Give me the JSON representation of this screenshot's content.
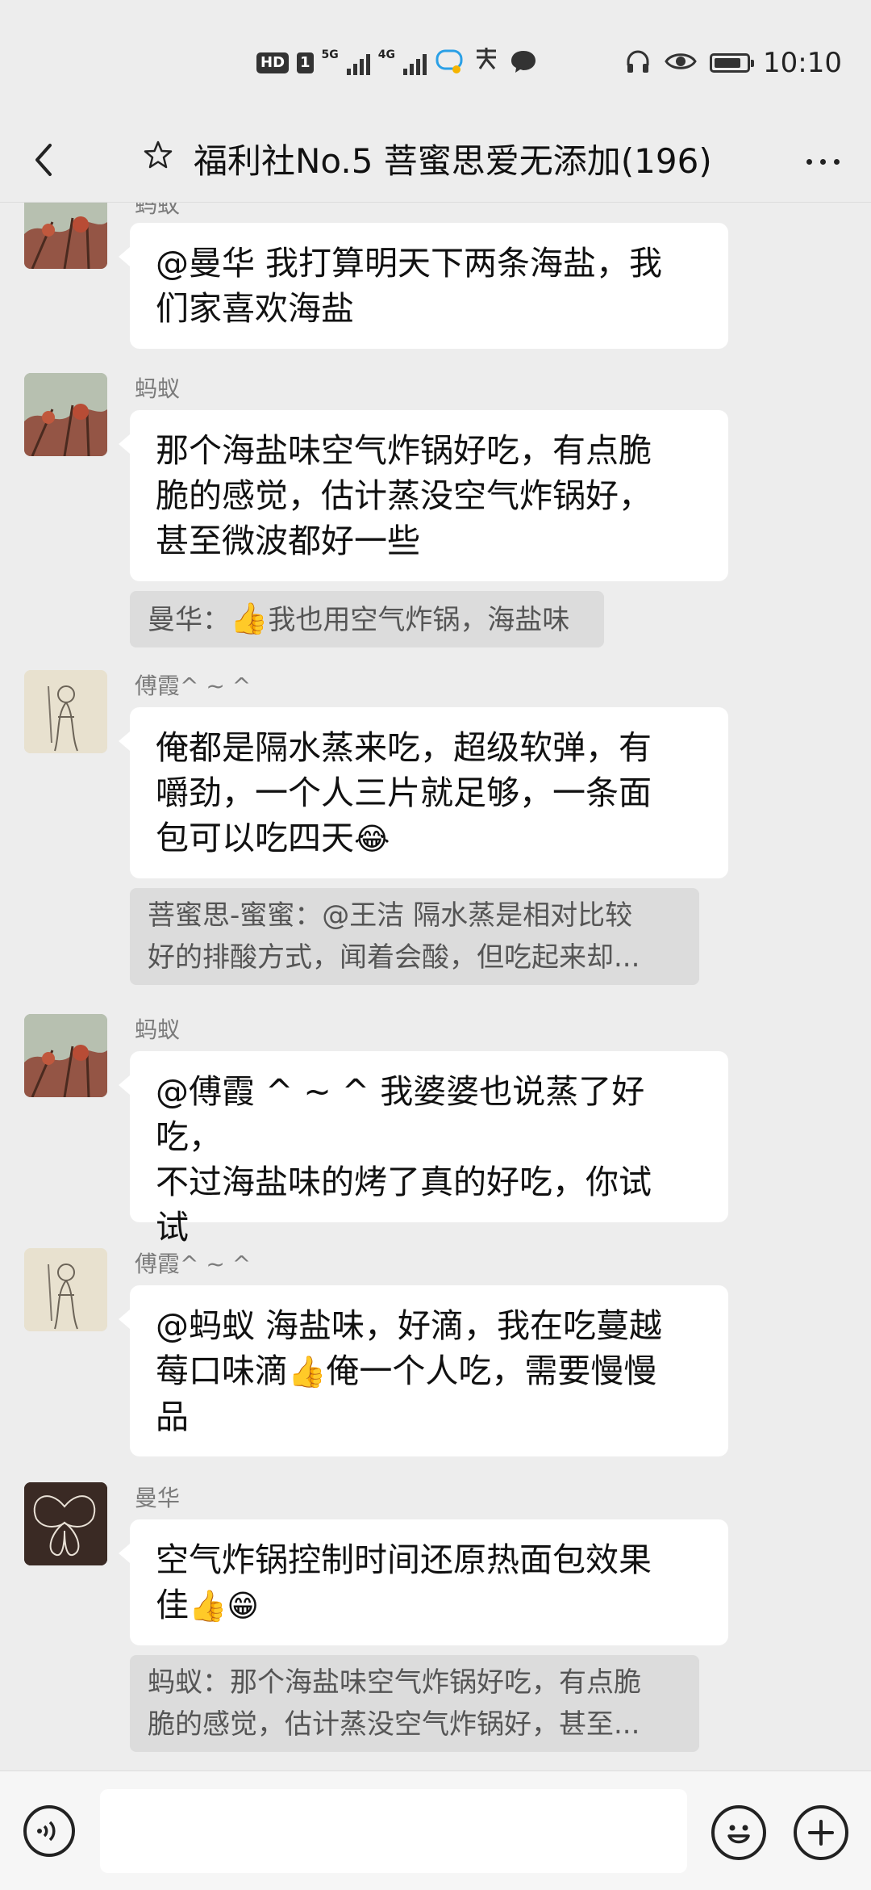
{
  "status_bar": {
    "hd": "HD",
    "sim": "1",
    "net1": "5G",
    "net2": "4G",
    "time": "10:10"
  },
  "header": {
    "title": "福利社No.5 菩蜜思爱无添加(196)"
  },
  "messages": [
    {
      "sender": "蚂蚁",
      "text": "@曼华  我打算明天下两条海盐，我们家喜欢海盐",
      "line1": "@曼华  我打算明天下两条海盐，我",
      "line2": "们家喜欢海盐",
      "avatar": "tree-painting"
    },
    {
      "sender": "蚂蚁",
      "line1": "那个海盐味空气炸锅好吃，有点脆",
      "line2": "脆的感觉，估计蒸没空气炸锅好，",
      "line3": "甚至微波都好一些",
      "avatar": "tree-painting",
      "quote": {
        "prefix": "曼华：",
        "emoji": "👍",
        "text": "我也用空气炸锅，海盐味"
      }
    },
    {
      "sender": "傅霞^ ~ ^",
      "line1": "俺都是隔水蒸来吃，超级软弹，有",
      "line2": "嚼劲，一个人三片就足够，一条面",
      "line3": "包可以吃四天",
      "line3_emoji": "😂",
      "avatar": "woman-sketch",
      "quote": {
        "line1": "菩蜜思-蜜蜜：@王洁 隔水蒸是相对比较",
        "line2": "好的排酸方式，闻着会酸，但吃起来却..."
      }
    },
    {
      "sender": "蚂蚁",
      "line1": "@傅霞 ^ ~ ^ 我婆婆也说蒸了好吃，",
      "line2": "不过海盐味的烤了真的好吃，你试",
      "line3": "试",
      "avatar": "tree-painting"
    },
    {
      "sender": "傅霞^ ~ ^",
      "line1": "@蚂蚁  海盐味，好滴，我在吃蔓越",
      "line2a": "莓口味滴",
      "line2_emoji": "👍",
      "line2b": "俺一个人吃，需要慢慢",
      "line3": "品",
      "avatar": "woman-sketch"
    },
    {
      "sender": "曼华",
      "line1": "空气炸锅控制时间还原热面包效果",
      "line2": "佳",
      "line2_emoji": "👍😁",
      "avatar": "butterfly",
      "quote": {
        "line1": "蚂蚁：那个海盐味空气炸锅好吃，有点脆",
        "line2": "脆的感觉，估计蒸没空气炸锅好，甚至..."
      }
    }
  ],
  "icons": {
    "back": "chevron-left-icon",
    "star": "star-icon",
    "more": "more-dots-icon",
    "voice": "voice-icon",
    "emoji": "emoji-icon",
    "plus": "plus-icon"
  }
}
